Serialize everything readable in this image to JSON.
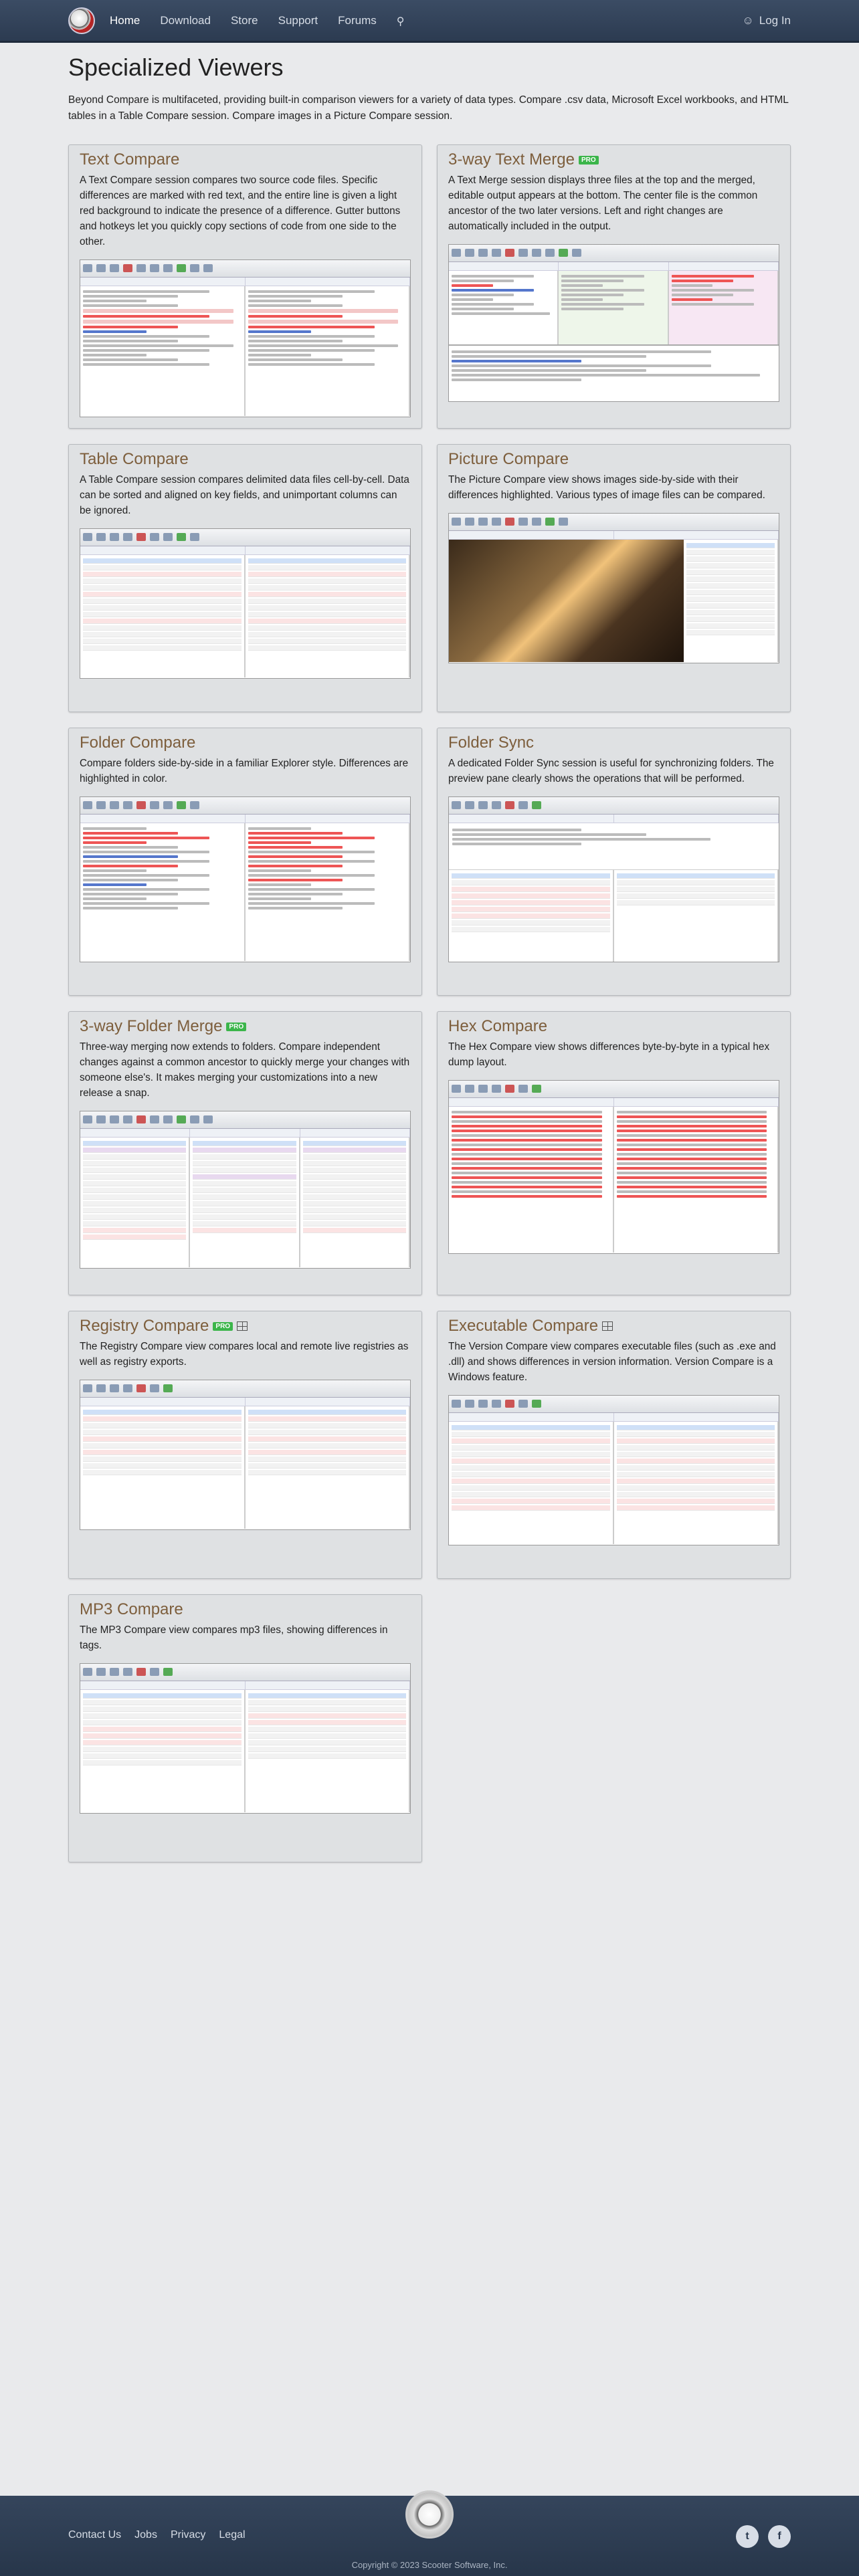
{
  "nav": {
    "items": [
      "Home",
      "Download",
      "Store",
      "Support",
      "Forums"
    ],
    "login": "Log In"
  },
  "page": {
    "title": "Specialized Viewers",
    "intro": "Beyond Compare is multifaceted, providing built-in comparison viewers for a variety of data types.  Compare .csv data, Microsoft Excel workbooks, and HTML tables in a Table Compare session.  Compare images in a Picture Compare session."
  },
  "cards": [
    {
      "title": "Text Compare",
      "pro": false,
      "windows": false,
      "text": "A Text Compare session compares two source code files.  Specific differences are marked with red text, and the entire line is given a light red background to indicate the presence of a difference.  Gutter buttons and hotkeys let you quickly copy sections of code from one side to the other."
    },
    {
      "title": "3-way Text Merge",
      "pro": true,
      "windows": false,
      "text": "A Text Merge session displays three files at the top and the merged, editable output appears at the bottom.  The center file is the common ancestor of the two later versions.  Left and right changes are automatically included in the output."
    },
    {
      "title": "Table Compare",
      "pro": false,
      "windows": false,
      "text": "A Table Compare session compares delimited data files cell-by-cell.  Data can be sorted and aligned on key fields, and unimportant columns can be ignored."
    },
    {
      "title": "Picture Compare",
      "pro": false,
      "windows": false,
      "text": "The Picture Compare view shows images side-by-side with their differences highlighted.  Various types of image files can be compared."
    },
    {
      "title": "Folder Compare",
      "pro": false,
      "windows": false,
      "text": "Compare folders side-by-side in a familiar Explorer style.  Differences are highlighted in color."
    },
    {
      "title": "Folder Sync",
      "pro": false,
      "windows": false,
      "text": "A dedicated Folder Sync session is useful for synchronizing folders.  The preview pane clearly shows the operations that will be performed."
    },
    {
      "title": "3-way Folder Merge",
      "pro": true,
      "windows": false,
      "text": "Three-way merging now extends to folders.  Compare independent changes against a common ancestor to quickly merge your changes with someone else's.  It makes merging your customizations into a new release a snap."
    },
    {
      "title": "Hex Compare",
      "pro": false,
      "windows": false,
      "text": "The Hex Compare view shows differences byte-by-byte in a typical hex dump layout."
    },
    {
      "title": "Registry Compare",
      "pro": true,
      "windows": true,
      "text": "The Registry Compare view compares local and remote live registries as well as registry exports."
    },
    {
      "title": "Executable Compare",
      "pro": false,
      "windows": true,
      "text": "The Version Compare view compares executable files (such as .exe and .dll) and shows differences in version information.  Version Compare is a Windows feature."
    },
    {
      "title": "MP3 Compare",
      "pro": false,
      "windows": false,
      "text": "The MP3 Compare view compares mp3 files, showing differences in tags."
    }
  ],
  "pro_badge": "PRO",
  "footer": {
    "links": [
      "Contact Us",
      "Jobs",
      "Privacy",
      "Legal"
    ],
    "copyright": "Copyright © 2023 Scooter Software, Inc."
  }
}
